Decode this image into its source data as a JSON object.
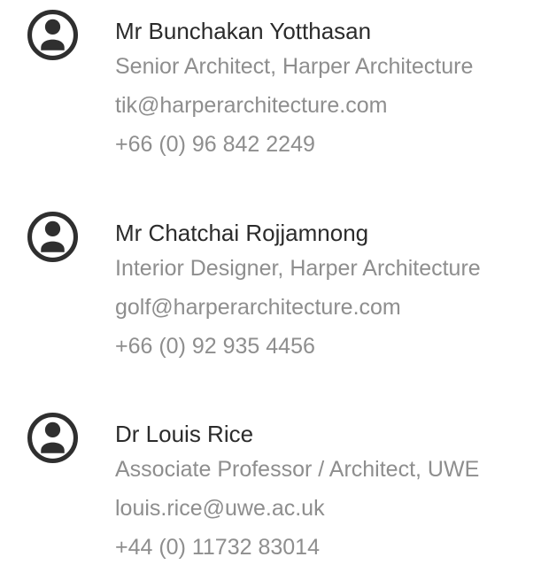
{
  "contacts": [
    {
      "name": "Mr Bunchakan Yotthasan",
      "role": "Senior Architect, Harper Architecture",
      "email": "tik@harperarchitecture.com",
      "phone": "+66 (0) 96 842 2249",
      "icon": "user-avatar-icon"
    },
    {
      "name": "Mr Chatchai Rojjamnong",
      "role": "Interior Designer, Harper Architecture",
      "email": "golf@harperarchitecture.com",
      "phone": "+66 (0) 92 935 4456",
      "icon": "user-avatar-icon"
    },
    {
      "name": "Dr Louis Rice",
      "role": "Associate Professor / Architect, UWE",
      "email": "louis.rice@uwe.ac.uk",
      "phone": "+44 (0) 11732 83014",
      "icon": "user-avatar-icon"
    }
  ],
  "colors": {
    "name": "#2b2b2b",
    "detail": "#8e8e8e",
    "icon": "#2f2f2f"
  }
}
